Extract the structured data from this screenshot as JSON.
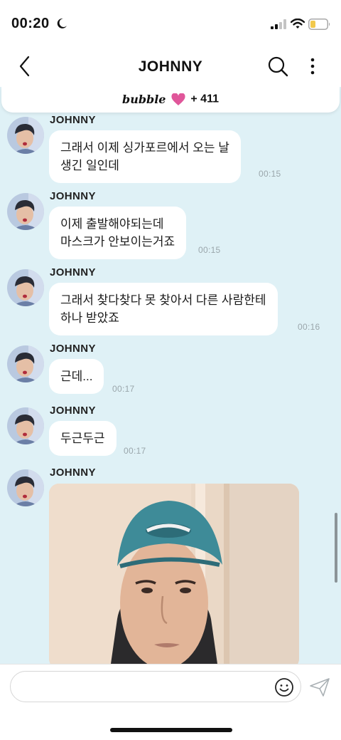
{
  "status_bar": {
    "time": "00:20",
    "icons": [
      "moon-icon",
      "signal-icon",
      "wifi-icon",
      "battery-icon"
    ]
  },
  "header": {
    "title": "JOHNNY",
    "icons": [
      "back-icon",
      "search-icon",
      "more-icon"
    ]
  },
  "bubble_banner": {
    "logo": "bubble",
    "icon": "heart-icon",
    "count": "+ 411"
  },
  "messages": [
    {
      "sender": "JOHNNY",
      "lines": [
        "그래서 이제 싱가포르에서 오는 날",
        "생긴 일인데"
      ],
      "time": "00:15"
    },
    {
      "sender": "JOHNNY",
      "lines": [
        "이제 출발해야되는데",
        "마스크가 안보이는거죠"
      ],
      "time": "00:15"
    },
    {
      "sender": "JOHNNY",
      "lines": [
        "그래서 찾다찾다 못 찾아서 다른 사람한테",
        "하나 받았죠"
      ],
      "time": "00:16"
    },
    {
      "sender": "JOHNNY",
      "lines": [
        "근데..."
      ],
      "time": "00:17"
    },
    {
      "sender": "JOHNNY",
      "lines": [
        "두근두근"
      ],
      "time": "00:17"
    },
    {
      "sender": "JOHNNY",
      "type": "photo"
    }
  ],
  "composer": {
    "placeholder": "",
    "icons": [
      "smiley-icon",
      "send-icon"
    ]
  },
  "colors": {
    "chat_background": "#dff1f6",
    "bubble_background": "#ffffff",
    "heart": "#e0569a",
    "timestamp": "#9aa6ab"
  }
}
